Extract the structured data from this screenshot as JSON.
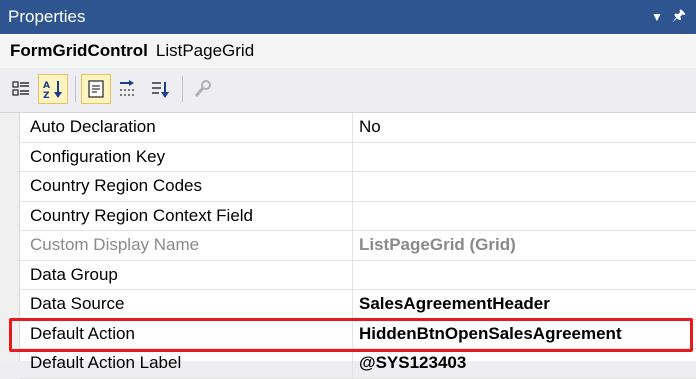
{
  "window": {
    "title": "Properties",
    "dropdown_icon": "dropdown-arrow-icon",
    "pin_icon": "pin-icon"
  },
  "object": {
    "type": "FormGridControl",
    "name": "ListPageGrid"
  },
  "toolbar": {
    "buttons": [
      {
        "name": "categorized-icon",
        "active": false
      },
      {
        "name": "alphabetical-sort-icon",
        "active": true
      },
      {
        "name": "properties-page-icon",
        "active": true
      },
      {
        "name": "events-icon",
        "active": false
      },
      {
        "name": "property-pages-icon",
        "active": false
      },
      {
        "name": "wrench-icon",
        "active": false
      }
    ]
  },
  "properties": [
    {
      "name": "Auto Declaration",
      "value": "No",
      "bold": false,
      "disabled": false
    },
    {
      "name": "Configuration Key",
      "value": "",
      "bold": false,
      "disabled": false
    },
    {
      "name": "Country Region Codes",
      "value": "",
      "bold": false,
      "disabled": false
    },
    {
      "name": "Country Region Context Field",
      "value": "",
      "bold": false,
      "disabled": false
    },
    {
      "name": "Custom Display Name",
      "value": "ListPageGrid (Grid)",
      "bold": true,
      "disabled": true
    },
    {
      "name": "Data Group",
      "value": "",
      "bold": false,
      "disabled": false
    },
    {
      "name": "Data Source",
      "value": "SalesAgreementHeader",
      "bold": true,
      "disabled": false
    },
    {
      "name": "Default Action",
      "value": "HiddenBtnOpenSalesAgreement",
      "bold": true,
      "disabled": false
    },
    {
      "name": "Default Action Label",
      "value": "@SYS123403",
      "bold": true,
      "disabled": false
    }
  ],
  "colors": {
    "titlebar": "#2f5591",
    "highlight": "#e8191c"
  }
}
